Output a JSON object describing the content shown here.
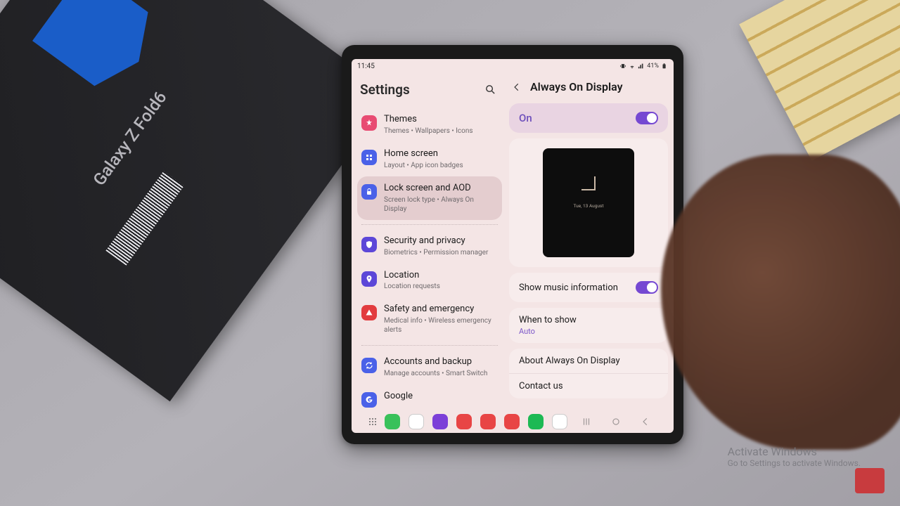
{
  "status": {
    "time": "11:45",
    "battery": "41%"
  },
  "settings_title": "Settings",
  "settings_items": [
    {
      "title": "Themes",
      "subtitle": "Themes • Wallpapers • Icons",
      "icon_bg": "#e84b72"
    },
    {
      "title": "Home screen",
      "subtitle": "Layout • App icon badges",
      "icon_bg": "#4a61e8"
    },
    {
      "title": "Lock screen and AOD",
      "subtitle": "Screen lock type • Always On Display",
      "icon_bg": "#4a61e8"
    },
    {
      "title": "Security and privacy",
      "subtitle": "Biometrics • Permission manager",
      "icon_bg": "#5c47d8"
    },
    {
      "title": "Location",
      "subtitle": "Location requests",
      "icon_bg": "#5c47d8"
    },
    {
      "title": "Safety and emergency",
      "subtitle": "Medical info • Wireless emergency alerts",
      "icon_bg": "#e23b3e"
    },
    {
      "title": "Accounts and backup",
      "subtitle": "Manage accounts • Smart Switch",
      "icon_bg": "#4a61e8"
    },
    {
      "title": "Google",
      "subtitle": "",
      "icon_bg": "#4a61e8"
    }
  ],
  "detail": {
    "title": "Always On Display",
    "main_toggle": "On",
    "preview_date": "Tue, 13 August",
    "music_info": "Show music information",
    "when_to_show_title": "When to show",
    "when_to_show_value": "Auto",
    "about": "About Always On Display",
    "contact": "Contact us"
  },
  "watermark": {
    "line1": "Activate Windows",
    "line2": "Go to Settings to activate Windows."
  },
  "box_label": "Galaxy Z Fold6"
}
